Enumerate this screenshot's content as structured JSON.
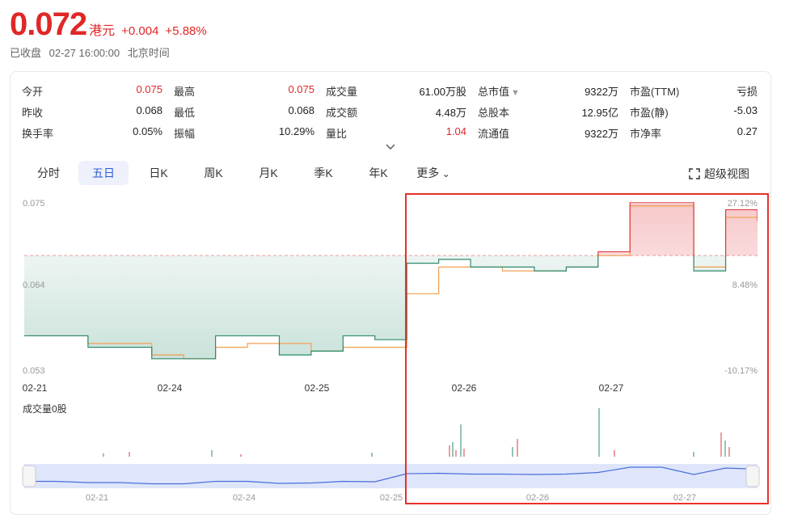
{
  "quote": {
    "price": "0.072",
    "currency": "港元",
    "change": "+0.004",
    "change_pct": "+5.88%",
    "status": "已收盘",
    "datetime": "02-27 16:00:00",
    "timezone": "北京时间"
  },
  "stats": [
    [
      {
        "label": "今开",
        "value": "0.075",
        "up": true
      },
      {
        "label": "最高",
        "value": "0.075",
        "up": true
      },
      {
        "label": "成交量",
        "value": "61.00万股",
        "up": false
      },
      {
        "label": "总市值",
        "value": "9322万",
        "up": false,
        "caret": true
      },
      {
        "label": "市盈(TTM)",
        "value": "亏损",
        "up": false
      }
    ],
    [
      {
        "label": "昨收",
        "value": "0.068",
        "up": false
      },
      {
        "label": "最低",
        "value": "0.068",
        "up": false
      },
      {
        "label": "成交额",
        "value": "4.48万",
        "up": false
      },
      {
        "label": "总股本",
        "value": "12.95亿",
        "up": false
      },
      {
        "label": "市盈(静)",
        "value": "-5.03",
        "up": false
      }
    ],
    [
      {
        "label": "换手率",
        "value": "0.05%",
        "up": false
      },
      {
        "label": "振幅",
        "value": "10.29%",
        "up": false
      },
      {
        "label": "量比",
        "value": "1.04",
        "up": true
      },
      {
        "label": "流通值",
        "value": "9322万",
        "up": false
      },
      {
        "label": "市净率",
        "value": "0.27",
        "up": false
      }
    ]
  ],
  "tabs": [
    "分时",
    "五日",
    "日K",
    "周K",
    "月K",
    "季K",
    "年K",
    "更多"
  ],
  "active_tab": 1,
  "fullscreen_label": "超级视图",
  "chart": {
    "y_labels": [
      "0.075",
      "0.064",
      "0.053"
    ],
    "pct_labels": [
      "27.12%",
      "8.48%",
      "-10.17%"
    ],
    "dates": [
      "02-21",
      "02-24",
      "02-25",
      "02-26",
      "02-27"
    ],
    "volume_label": "成交量0股",
    "up_color": "#e0393e",
    "down_color": "#2e8a6e",
    "avg_color": "#f0a050",
    "nav_color": "#4a6fd8",
    "highlight_color": "#e8302a"
  },
  "chart_data": {
    "type": "line",
    "x": [
      "02-21",
      "02-24",
      "02-25",
      "02-26",
      "02-27"
    ],
    "ylim": [
      0.053,
      0.075
    ],
    "prev_close": 0.068,
    "series": [
      {
        "values": [
          0.0575,
          0.0575,
          0.056,
          0.056,
          0.0545,
          0.0545,
          0.0575,
          0.0575,
          0.055,
          0.0555,
          0.0575,
          0.057,
          0.067,
          0.0675,
          0.0665,
          0.0665,
          0.066,
          0.0665,
          0.0685,
          0.075,
          0.075,
          0.066,
          0.074,
          0.0725
        ]
      },
      {
        "values": [
          0.0575,
          0.0575,
          0.0565,
          0.0565,
          0.055,
          0.0545,
          0.056,
          0.0565,
          0.0565,
          0.0555,
          0.056,
          0.056,
          0.063,
          0.0665,
          0.0665,
          0.066,
          0.066,
          0.0665,
          0.068,
          0.0745,
          0.0745,
          0.0665,
          0.073,
          0.073
        ]
      }
    ]
  }
}
